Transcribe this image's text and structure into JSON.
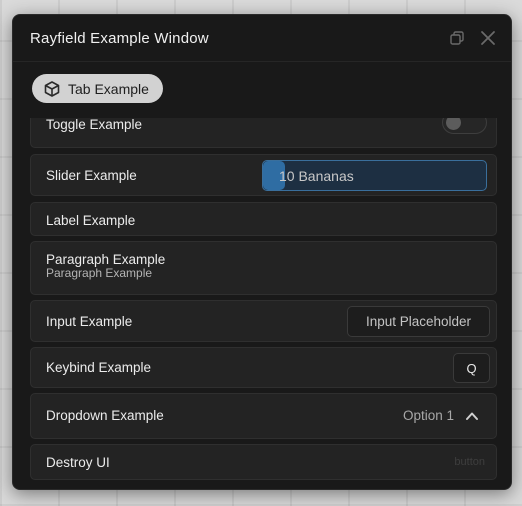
{
  "window": {
    "title": "Rayfield Example Window",
    "controls": {
      "minimize_icon": "window-restore-icon",
      "close_icon": "close-icon"
    }
  },
  "tabs": [
    {
      "label": "Tab Example",
      "icon": "cube-icon",
      "selected": true
    }
  ],
  "elements": {
    "toggle": {
      "label": "Toggle Example",
      "value": false
    },
    "slider": {
      "label": "Slider Example",
      "value_text": "10 Bananas",
      "fill_fraction": 0.1
    },
    "label": {
      "label": "Label Example"
    },
    "paragraph": {
      "title": "Paragraph Example",
      "content": "Paragraph Example"
    },
    "input": {
      "label": "Input Example",
      "placeholder": "Input Placeholder"
    },
    "keybind": {
      "label": "Keybind Example",
      "key": "Q"
    },
    "dropdown": {
      "label": "Dropdown Example",
      "selected": "Option 1",
      "icon": "chevron-up-icon"
    },
    "button": {
      "label": "Destroy UI",
      "hint": "button"
    }
  },
  "colors": {
    "window_bg": "#191919",
    "element_bg": "#232323",
    "slider_accent": "#2f6da3",
    "tab_selected_bg": "#d2d2d2"
  }
}
